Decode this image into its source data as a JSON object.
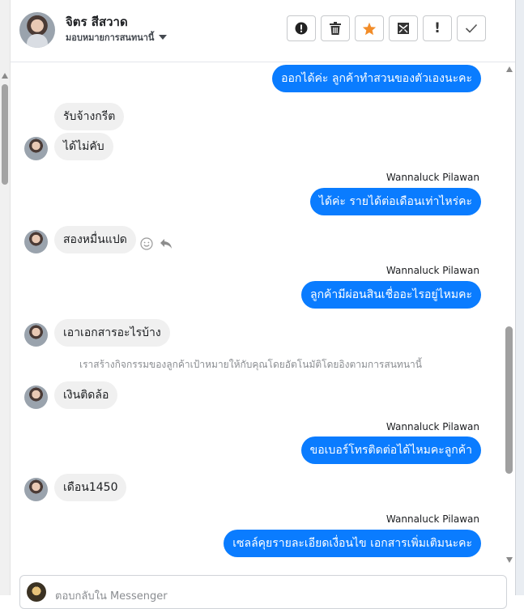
{
  "header": {
    "contact_name": "จิตร สีสวาด",
    "assign_label": "มอบหมายการสนทนานี้"
  },
  "toolbar": {
    "buttons": [
      "mark-spam",
      "delete",
      "star",
      "mark-unread",
      "follow-up",
      "mark-done"
    ],
    "follow_up_glyph": "!",
    "star_color": "#f28c28"
  },
  "messages": [
    {
      "dir": "out",
      "text": "ออกได้ค่ะ ลูกค้าทำสวนของตัวเองนะคะ"
    },
    {
      "dir": "in",
      "text": "รับจ้างกรีต"
    },
    {
      "dir": "in",
      "text": "ได้ไม่คับ"
    },
    {
      "dir": "out",
      "sender": "Wannaluck Pilawan",
      "text": "ได้ค่ะ รายได้ต่อเดือนเท่าไหร่คะ"
    },
    {
      "dir": "in",
      "text": "สองหมื่นแปด"
    },
    {
      "dir": "out",
      "sender": "Wannaluck Pilawan",
      "text": "ลูกค้ามีผ่อนสินเชื่ออะไรอยู่ไหมคะ"
    },
    {
      "dir": "in",
      "text": "เอาเอกสารอะไรบ้าง"
    },
    {
      "dir": "system",
      "text": "เราสร้างกิจกรรมของลูกค้าเป้าหมายให้กับคุณโดยอัตโนมัติโดยอิงตามการสนทนานี้"
    },
    {
      "dir": "in",
      "text": "เงินติดล้อ"
    },
    {
      "dir": "out",
      "sender": "Wannaluck Pilawan",
      "text": "ขอเบอร์โทรติดต่อได้ไหมคะลูกค้า"
    },
    {
      "dir": "in",
      "text": "เดือน1450"
    },
    {
      "dir": "out",
      "sender": "Wannaluck Pilawan",
      "text": "เซลล์คุยรายละเอียดเงื่อนไข เอกสารเพิ่มเติมนะคะ"
    }
  ],
  "composer": {
    "placeholder": "ตอบกลับใน Messenger"
  },
  "colors": {
    "outgoing_bubble": "#0a7cff",
    "incoming_bubble": "#f0f0f0"
  }
}
